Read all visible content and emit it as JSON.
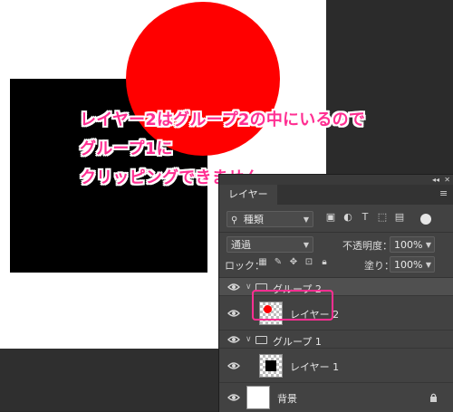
{
  "annotation": {
    "line1": "レイヤー2はグループ2の中にいるので",
    "line2": "グループ1に",
    "line3": "クリッピングできません",
    "color": "#ff2f92"
  },
  "panel": {
    "tab_label": "レイヤー",
    "filter": {
      "icon": "search-icon",
      "value": "種類"
    },
    "blend_mode": "通過",
    "opacity_label": "不透明度：",
    "opacity_value": "100%",
    "lock_label": "ロック：",
    "fill_label": "塗り：",
    "fill_value": "100%"
  },
  "layers": {
    "group2_name": "グループ 2",
    "layer2_name": "レイヤー 2",
    "group1_name": "グループ 1",
    "layer1_name": "レイヤー 1",
    "background_name": "背景"
  },
  "colors": {
    "red": "#ff0000",
    "black": "#000000",
    "white": "#ffffff",
    "panel": "#424242"
  }
}
